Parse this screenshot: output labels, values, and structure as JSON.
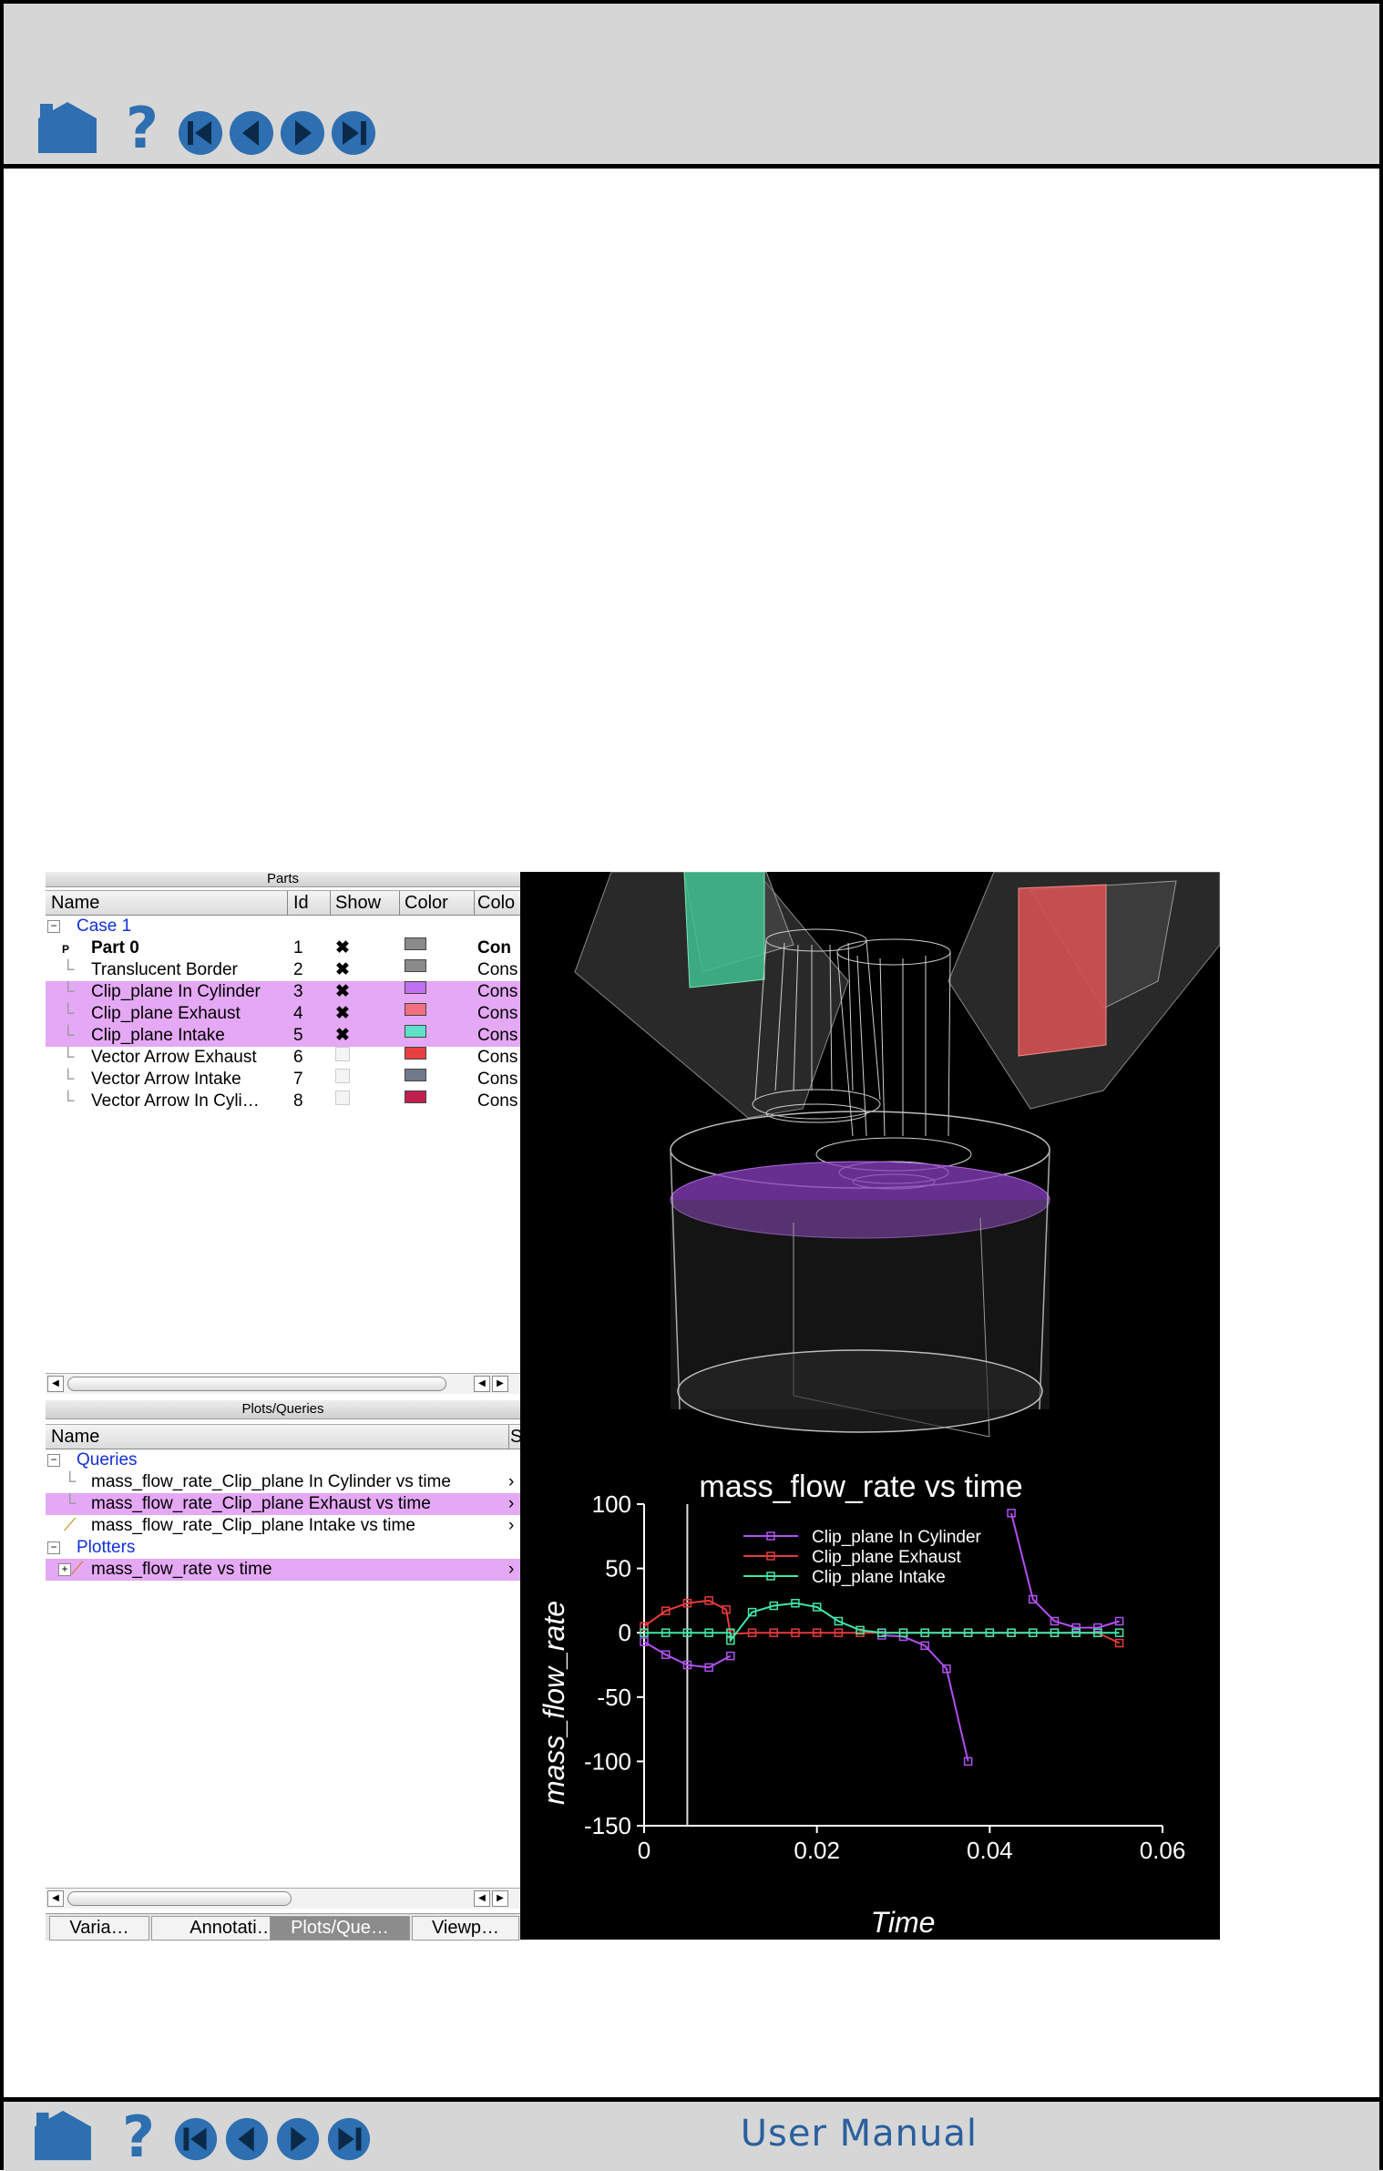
{
  "nav": {
    "icons": [
      "home-icon",
      "help-icon",
      "first-page-icon",
      "previous-page-icon",
      "next-page-icon",
      "last-page-icon"
    ],
    "footer_title": "User Manual"
  },
  "parts_panel": {
    "title": "Parts",
    "columns": [
      "Name",
      "Id",
      "Show",
      "Color",
      "Colo"
    ],
    "case_label": "Case 1",
    "rows": [
      {
        "name": "Part 0",
        "id": "1",
        "show": true,
        "color": "#8a8a8a",
        "mode": "Con",
        "bold": true,
        "selected": false
      },
      {
        "name": "Translucent Border",
        "id": "2",
        "show": true,
        "color": "#8a8a8a",
        "mode": "Cons",
        "bold": false,
        "selected": false
      },
      {
        "name": "Clip_plane In Cylinder",
        "id": "3",
        "show": true,
        "color": "#c070f0",
        "mode": "Cons",
        "bold": false,
        "selected": true
      },
      {
        "name": "Clip_plane Exhaust",
        "id": "4",
        "show": true,
        "color": "#f07080",
        "mode": "Cons",
        "bold": false,
        "selected": true
      },
      {
        "name": "Clip_plane Intake",
        "id": "5",
        "show": true,
        "color": "#60e0c8",
        "mode": "Cons",
        "bold": false,
        "selected": true
      },
      {
        "name": "Vector Arrow Exhaust",
        "id": "6",
        "show": false,
        "color": "#e84040",
        "mode": "Cons",
        "bold": false,
        "selected": false
      },
      {
        "name": "Vector Arrow Intake",
        "id": "7",
        "show": false,
        "color": "#707a8c",
        "mode": "Cons",
        "bold": false,
        "selected": false
      },
      {
        "name": "Vector Arrow In Cyli…",
        "id": "8",
        "show": false,
        "color": "#c02050",
        "mode": "Cons",
        "bold": false,
        "selected": false
      }
    ]
  },
  "plots_panel": {
    "title": "Plots/Queries",
    "column_name": "Name",
    "column_s": "S",
    "queries_label": "Queries",
    "queries": [
      {
        "name": "mass_flow_rate_Clip_plane In Cylinder vs time",
        "selected": false
      },
      {
        "name": "mass_flow_rate_Clip_plane Exhaust vs time",
        "selected": true
      },
      {
        "name": "mass_flow_rate_Clip_plane Intake vs time",
        "selected": false
      }
    ],
    "plotters_label": "Plotters",
    "plotter": "mass_flow_rate vs time"
  },
  "tabs": [
    "Varia…",
    "Annotati…",
    "Plots/Que…",
    "Viewp…"
  ],
  "active_tab": 2,
  "chart_data": {
    "type": "line",
    "title": "mass_flow_rate vs time",
    "xlabel": "Time",
    "ylabel": "mass_flow_rate",
    "xlim": [
      0,
      0.06
    ],
    "ylim": [
      -150,
      100
    ],
    "xticks": [
      "0",
      "0.02",
      "0.04",
      "0.06"
    ],
    "yticks": [
      "100",
      "50",
      "0",
      "-50",
      "-100",
      "-150"
    ],
    "marker_line_x": 0.005,
    "legend_position": "top-center",
    "series": [
      {
        "name": "Clip_plane In Cylinder",
        "color": "#b050f0",
        "segments": [
          [
            [
              0,
              -7
            ],
            [
              0.0025,
              -17
            ],
            [
              0.005,
              -25
            ],
            [
              0.0075,
              -27
            ],
            [
              0.01,
              -18
            ]
          ],
          [
            [
              0.0275,
              -2
            ],
            [
              0.03,
              -3
            ],
            [
              0.0325,
              -10
            ],
            [
              0.035,
              -28
            ],
            [
              0.0375,
              -100
            ]
          ],
          [
            [
              0.0425,
              93
            ],
            [
              0.045,
              26
            ],
            [
              0.0475,
              9
            ],
            [
              0.05,
              4
            ],
            [
              0.0525,
              4
            ],
            [
              0.055,
              9
            ]
          ]
        ]
      },
      {
        "name": "Clip_plane Exhaust",
        "color": "#e83a3a",
        "segments": [
          [
            [
              0,
              5
            ],
            [
              0.0025,
              17
            ],
            [
              0.005,
              23
            ],
            [
              0.0075,
              25
            ],
            [
              0.0095,
              18
            ],
            [
              0.01,
              -1
            ],
            [
              0.0125,
              0
            ],
            [
              0.015,
              0
            ],
            [
              0.0175,
              0
            ],
            [
              0.02,
              0
            ],
            [
              0.0225,
              0
            ],
            [
              0.025,
              0
            ],
            [
              0.0275,
              0
            ],
            [
              0.03,
              0
            ],
            [
              0.0325,
              0
            ],
            [
              0.035,
              0
            ],
            [
              0.0375,
              0
            ],
            [
              0.04,
              0
            ],
            [
              0.0425,
              0
            ],
            [
              0.045,
              0
            ],
            [
              0.0475,
              0
            ],
            [
              0.05,
              0
            ],
            [
              0.0525,
              0
            ],
            [
              0.055,
              -8
            ]
          ]
        ]
      },
      {
        "name": "Clip_plane Intake",
        "color": "#40e8a8",
        "segments": [
          [
            [
              0,
              0
            ],
            [
              0.0025,
              0
            ],
            [
              0.005,
              0
            ],
            [
              0.0075,
              0
            ],
            [
              0.01,
              0
            ],
            [
              0.01,
              -6
            ],
            [
              0.0125,
              16
            ],
            [
              0.015,
              21
            ],
            [
              0.0175,
              23
            ],
            [
              0.02,
              20
            ],
            [
              0.0225,
              9
            ],
            [
              0.025,
              2
            ],
            [
              0.0275,
              0
            ],
            [
              0.03,
              0
            ],
            [
              0.0325,
              0
            ],
            [
              0.035,
              0
            ],
            [
              0.0375,
              0
            ],
            [
              0.04,
              0
            ],
            [
              0.0425,
              0
            ],
            [
              0.045,
              0
            ],
            [
              0.0475,
              0
            ],
            [
              0.05,
              0
            ],
            [
              0.0525,
              0
            ],
            [
              0.055,
              0
            ]
          ]
        ]
      }
    ]
  }
}
